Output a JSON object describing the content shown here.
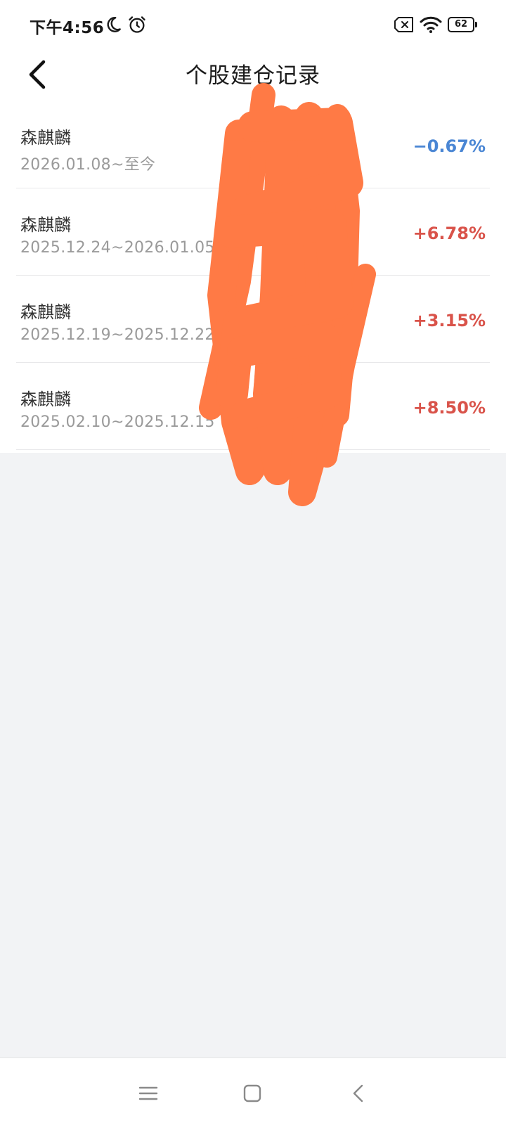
{
  "status_bar": {
    "time": "下午4:56",
    "battery": "62"
  },
  "header": {
    "title": "个股建仓记录"
  },
  "records": [
    {
      "name": "森麒麟",
      "range": "2026.01.08~至今",
      "change": "−0.67%",
      "color": "#4a86d4"
    },
    {
      "name": "森麒麟",
      "range": "2025.12.24~2026.01.05",
      "change": "+6.78%",
      "color": "#d9534a"
    },
    {
      "name": "森麒麟",
      "range": "2025.12.19~2025.12.22",
      "change": "+3.15%",
      "color": "#d9534a"
    },
    {
      "name": "森麒麟",
      "range": "2025.02.10~2025.12.15",
      "change": "+8.50%",
      "color": "#d9534a"
    }
  ],
  "icons": {
    "back": "chevron-left-icon",
    "moon": "moon-icon",
    "alarm": "alarm-clock-icon",
    "sim": "no-sim-icon",
    "wifi": "wifi-icon",
    "battery": "battery-icon",
    "nav_menu": "menu-icon",
    "nav_home": "home-square-icon",
    "nav_back": "back-triangle-icon"
  },
  "colors": {
    "negative": "#4a86d4",
    "positive": "#d9534a",
    "scribble": "#ff7a45",
    "background": "#f2f3f5"
  }
}
